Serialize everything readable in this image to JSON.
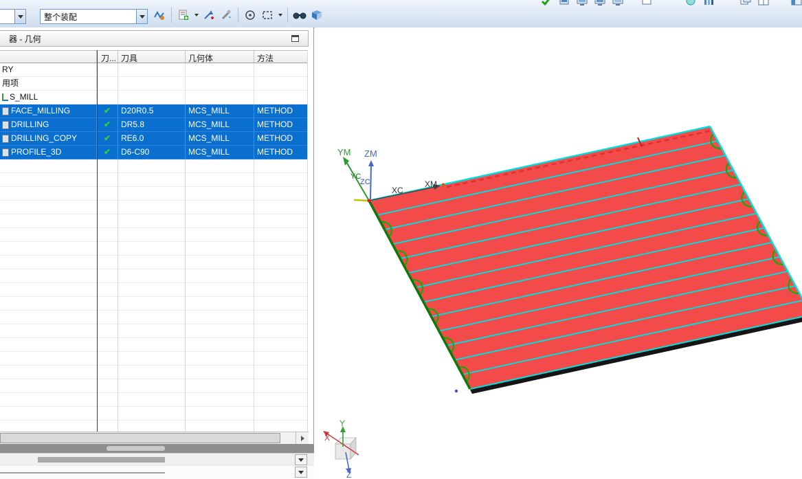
{
  "toolbar": {
    "assembly_combo": {
      "value": "整个装配"
    },
    "left_icons": [
      "show-toolpath-icon",
      "create-operation-icon",
      "add-operation-icon",
      "edit-tool-icon",
      "snap-point-icon",
      "selection-box-icon",
      "visibility-glasses-icon",
      "layer-cube-icon"
    ],
    "right_icons": [
      "verify-check-icon",
      "machine-icon",
      "monitor-icon-1",
      "monitor-icon-2",
      "monitor-icon-3",
      "window-icon",
      "sphere-icon",
      "cascade-window-icon",
      "panel-icon"
    ]
  },
  "navigator": {
    "title": "器 - 几何",
    "columns": {
      "name": "",
      "track": "刀...",
      "tool": "刀具",
      "geometry": "几何体",
      "method": "方法"
    },
    "rows": [
      {
        "name": "RY"
      },
      {
        "name": "用项"
      },
      {
        "name": "S_MILL"
      },
      {
        "name": "FACE_MILLING",
        "check": "✔",
        "tool": "D20R0.5",
        "geometry": "MCS_MILL",
        "method": "METHOD"
      },
      {
        "name": "DRILLING",
        "check": "✔",
        "tool": "DR5.8",
        "geometry": "MCS_MILL",
        "method": "METHOD"
      },
      {
        "name": "DRILLING_COPY",
        "check": "✔",
        "tool": "RE6.0",
        "geometry": "MCS_MILL",
        "method": "METHOD"
      },
      {
        "name": "PROFILE_3D",
        "check": "✔",
        "tool": "D6-C90",
        "geometry": "MCS_MILL",
        "method": "METHOD"
      }
    ]
  },
  "viewport": {
    "axes": {
      "ym": "YM",
      "zm": "ZM",
      "yc": "YC",
      "zc": "ZC",
      "xc": "XC",
      "xm": "XM"
    },
    "triad": {
      "x": "X",
      "y": "Y",
      "z": "Z"
    },
    "toolpath": {
      "passes": 13,
      "red": "#f34a4a",
      "cyan": "#00dede",
      "green": "#00b400",
      "dash_red": "#e03030"
    }
  }
}
